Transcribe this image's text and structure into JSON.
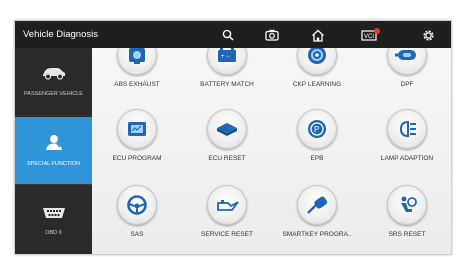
{
  "header": {
    "title": "Vehicle Diagnosis",
    "icons": [
      "search-icon",
      "screenshot-icon",
      "home-icon",
      "vci-icon",
      "settings-icon"
    ],
    "accent_color": "#2f94d8",
    "badge_color": "#e53935"
  },
  "sidebar": {
    "items": [
      {
        "label": "PASSENGER VEHICLE",
        "icon": "car-icon",
        "active": false
      },
      {
        "label": "SPECIAL FUNCTION",
        "icon": "mechanic-icon",
        "active": true
      },
      {
        "label": "OBD II",
        "icon": "obd-connector-icon",
        "active": false
      }
    ]
  },
  "functions": [
    {
      "label": "ABS EXHAUST",
      "icon": "abs-exhaust-icon"
    },
    {
      "label": "BATTERY MATCH",
      "icon": "battery-icon"
    },
    {
      "label": "CKP LEARNING",
      "icon": "crankshaft-icon"
    },
    {
      "label": "DPF",
      "icon": "dpf-icon"
    },
    {
      "label": "ECU PROGRAM",
      "icon": "ecu-program-icon"
    },
    {
      "label": "ECU RESET",
      "icon": "ecu-reset-icon"
    },
    {
      "label": "EPB",
      "icon": "parking-brake-icon"
    },
    {
      "label": "LAMP ADAPTION",
      "icon": "headlamp-icon"
    },
    {
      "label": "SAS",
      "icon": "steering-wheel-icon"
    },
    {
      "label": "SERVICE RESET",
      "icon": "oil-can-icon"
    },
    {
      "label": "SMARTKEY PROGRA..",
      "icon": "smart-key-icon"
    },
    {
      "label": "SRS RESET",
      "icon": "airbag-icon"
    }
  ]
}
